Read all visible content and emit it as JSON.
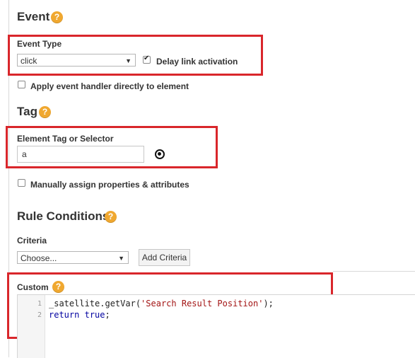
{
  "event": {
    "title": "Event",
    "help": "?",
    "event_type_label": "Event Type",
    "event_type_value": "click",
    "delay_link_label": "Delay link activation",
    "delay_link_checked": true,
    "apply_handler_label": "Apply event handler directly to element",
    "apply_handler_checked": false
  },
  "tag": {
    "title": "Tag",
    "help": "?",
    "selector_label": "Element Tag or Selector",
    "selector_value": "a",
    "manual_label": "Manually assign properties & attributes",
    "manual_checked": false
  },
  "rule_conditions": {
    "title": "Rule Conditions",
    "help": "?",
    "criteria_label": "Criteria",
    "criteria_value": "Choose...",
    "add_criteria_label": "Add Criteria",
    "custom_label": "Custom",
    "custom_help": "?"
  },
  "code": {
    "lines": [
      {
        "num": "1",
        "prefix": "_satellite.getVar(",
        "string": "'Search Result Position'",
        "suffix": ");"
      },
      {
        "num": "2",
        "keyword": "return",
        "space": " ",
        "bool": "true",
        "end": ";"
      }
    ]
  },
  "colors": {
    "highlight": "#d9262b",
    "help_icon": "#f0a830"
  }
}
